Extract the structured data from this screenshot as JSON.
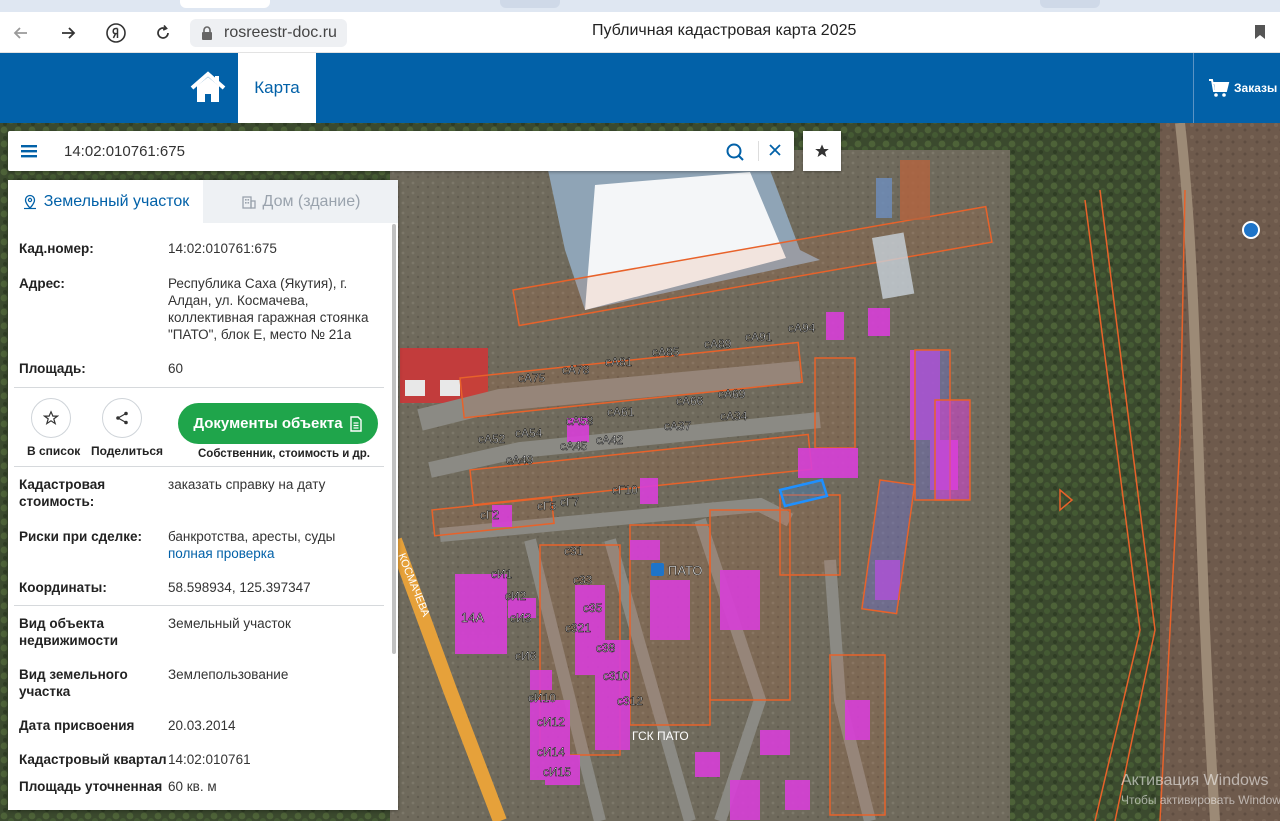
{
  "browser": {
    "url": "rosreestr-doc.ru",
    "page_title": "Публичная кадастровая карта 2025"
  },
  "header": {
    "tab_label": "Карта",
    "orders_label": "Заказы"
  },
  "search": {
    "value": "14:02:010761:675"
  },
  "panel": {
    "tab_land": "Земельный участок",
    "tab_house": "Дом (здание)",
    "cad_number": {
      "label": "Кад.номер:",
      "value": "14:02:010761:675"
    },
    "address": {
      "label": "Адрес:",
      "value": "Республика Саха (Якутия), г. Алдан, ул. Космачева, коллективная гаражная стоянка \"ПАТО\", блок Е, место № 21а"
    },
    "area": {
      "label": "Площадь:",
      "value": "60"
    },
    "actions": {
      "add_list": "В список",
      "share": "Поделиться",
      "docs_button": "Документы объекта",
      "docs_sub": "Собственник, стоимость и др."
    },
    "cad_value": {
      "label": "Кадастровая стоимость:",
      "link": "заказать справку на дату"
    },
    "risks": {
      "label": "Риски при сделке:",
      "value": "банкротства, аресты, суды",
      "link": "полная проверка"
    },
    "coords": {
      "label": "Координаты:",
      "value": "58.598934, 125.397347"
    },
    "object_type": {
      "label": "Вид объекта недвижимости",
      "value": "Земельный участок"
    },
    "land_type": {
      "label": "Вид земельного участка",
      "value": "Землепользование"
    },
    "assigned_date": {
      "label": "Дата присвоения",
      "value": "20.03.2014"
    },
    "cad_quarter": {
      "label": "Кадастровый квартал",
      "value": "14:02:010761"
    },
    "area_clarified": {
      "label": "Площадь уточненная",
      "value": "60 кв. м"
    }
  },
  "map_labels": {
    "plots": [
      "сА75",
      "сА78",
      "сА81",
      "сА85",
      "сА89",
      "сА91",
      "сА94",
      "сА52",
      "сА54",
      "сА58",
      "сА61",
      "сА66",
      "сА69",
      "сА49",
      "сА45",
      "сА42",
      "сА37",
      "сА34",
      "сГ2",
      "сГ5",
      "сГ7",
      "сГ10",
      "сИ1",
      "сИ2",
      "сИ3",
      "сИ6",
      "сИ10",
      "сИ12",
      "сИ14",
      "сИ15",
      "с31",
      "с33",
      "с35",
      "с321",
      "с38",
      "с310",
      "с312",
      "14А"
    ],
    "street": "КОСМАЧЕВА",
    "poi": "ПАТО",
    "gsk": "ГСК ПАТО"
  },
  "watermark": {
    "line1": "Активация Windows",
    "line2": "Чтобы активировать Windows"
  },
  "colors": {
    "brand_blue": "#0261a8",
    "green_button": "#1fa54b",
    "plot_magenta": "#d83fd8",
    "plot_outline": "#e8622a"
  }
}
